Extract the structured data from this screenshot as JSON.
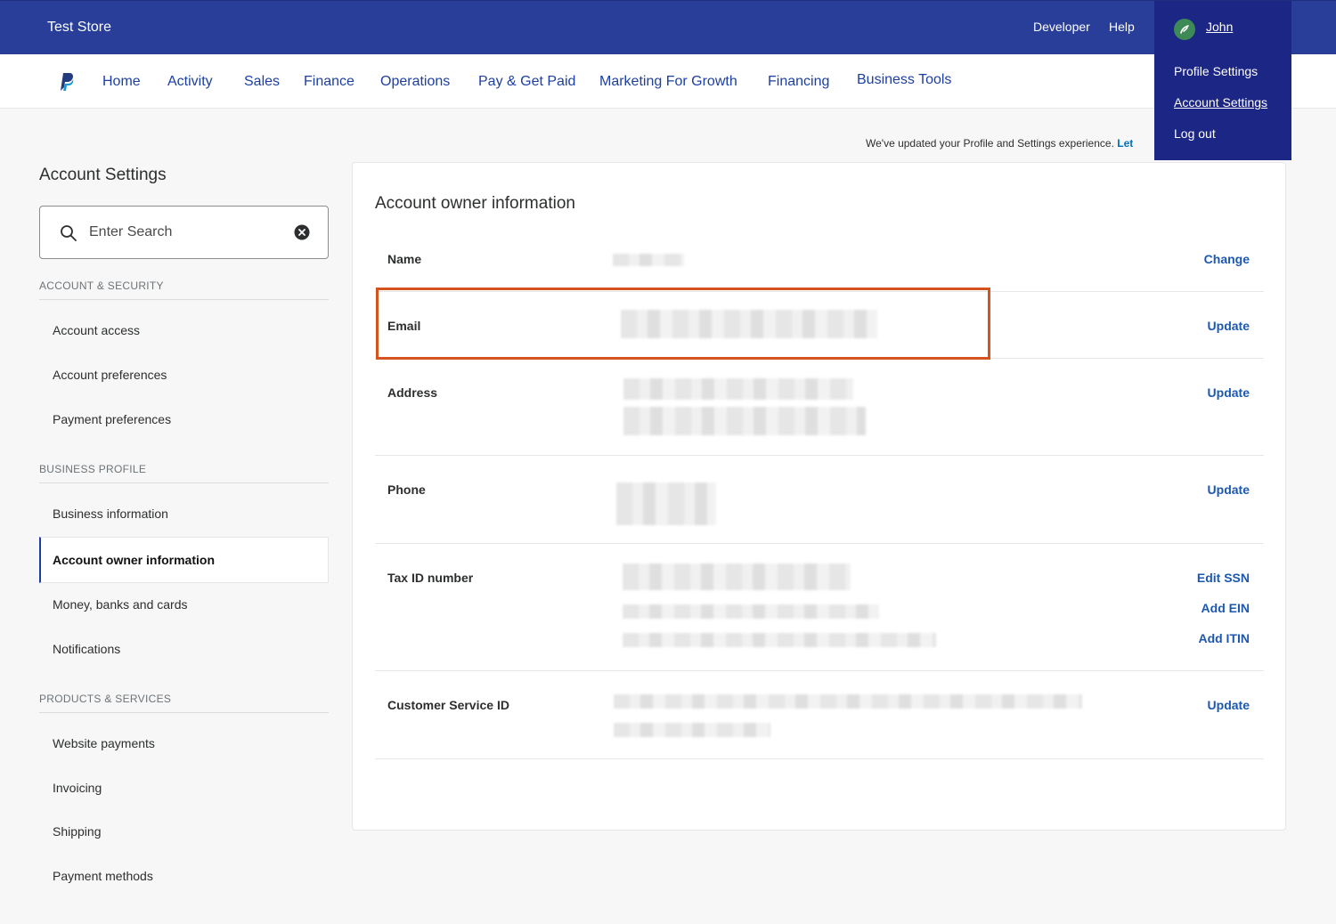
{
  "header": {
    "store_name": "Test Store",
    "developer_label": "Developer",
    "help_label": "Help",
    "user_name": "John"
  },
  "user_menu": {
    "items": [
      "Profile Settings",
      "Account Settings",
      "Log out"
    ]
  },
  "nav": {
    "items": [
      "Home",
      "Activity",
      "Sales",
      "Finance",
      "Operations",
      "Pay & Get Paid",
      "Marketing For Growth",
      "Financing",
      "Business Tools"
    ]
  },
  "notice": {
    "text": "We've updated your Profile and Settings experience.",
    "link": "Let"
  },
  "sidebar": {
    "title": "Account Settings",
    "search_placeholder": "Enter Search",
    "sections": [
      {
        "label": "ACCOUNT & SECURITY",
        "items": [
          "Account access",
          "Account preferences",
          "Payment preferences"
        ]
      },
      {
        "label": "BUSINESS PROFILE",
        "items": [
          "Business information",
          "Account owner information",
          "Money, banks and cards",
          "Notifications"
        ]
      },
      {
        "label": "PRODUCTS & SERVICES",
        "items": [
          "Website payments",
          "Invoicing",
          "Shipping",
          "Payment methods"
        ]
      }
    ],
    "active_item": "Account owner information"
  },
  "main": {
    "title": "Account owner information",
    "rows": [
      {
        "label": "Name",
        "actions": [
          "Change"
        ]
      },
      {
        "label": "Email",
        "actions": [
          "Update"
        ]
      },
      {
        "label": "Address",
        "actions": [
          "Update"
        ]
      },
      {
        "label": "Phone",
        "actions": [
          "Update"
        ]
      },
      {
        "label": "Tax ID number",
        "actions": [
          "Edit SSN",
          "Add EIN",
          "Add ITIN"
        ]
      },
      {
        "label": "Customer Service ID",
        "actions": [
          "Update"
        ]
      }
    ]
  },
  "colors": {
    "header_bg": "#283e98",
    "menu_bg": "#1c2684",
    "link_blue": "#1d58b0",
    "highlight": "#d4531f"
  }
}
